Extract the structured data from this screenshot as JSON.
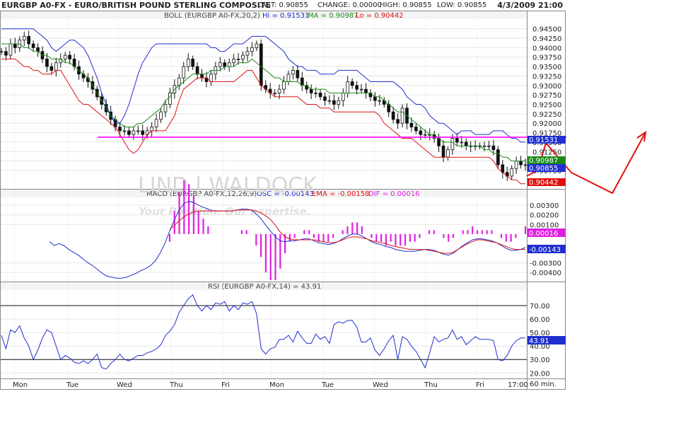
{
  "header": {
    "symbol_title": "EURGBP A0-FX - EURO/BRITISH POUND STERLING COMPOSITE",
    "last": "LAST: 0.90855",
    "change": "CHANGE: 0.00000",
    "high": "HIGH: 0.90855",
    "low": "LOW: 0.90855",
    "datetime": "4/3/2009 21:00"
  },
  "panels": {
    "boll": {
      "title": "BOLL (EURGBP A0-FX,20,2)",
      "hi": "Hi = 0.91531",
      "ma": "MA = 0.90987",
      "lo": "Lo = 0.90442"
    },
    "macd": {
      "title": "MACD (EURGBP A0-FX,12,26,9)",
      "osc": "OSC = -0.00143",
      "ema": "EMA = -0.00158",
      "dif": "DIF = 0.00016"
    },
    "rsi": {
      "title": "RSI (EURGBP A0-FX,14) = 43.91"
    }
  },
  "watermark": {
    "name": "LIND | WALDOCK",
    "tagline": "Your Position. Our expertise."
  },
  "badges": {
    "boll_hi": "0.91531",
    "ma": "0.90987",
    "last": "0.90855",
    "boll_lo": "0.90442",
    "macd_dif": "0.00016",
    "macd_osc": "-0.00143",
    "rsi": "43.91"
  },
  "interval_label": "60 min.",
  "colors": {
    "price_bars": "#111111",
    "upper_band": "#1f2fd0",
    "middle_band": "#1a8a1a",
    "lower_band": "#e01010",
    "macd_line": "#1f2fd0",
    "signal_line": "#e01010",
    "histogram": "#e020e0",
    "rsi_line": "#1f2fd0",
    "drawn_line": "#ff00ff",
    "annotation": "#e01010"
  },
  "chart_data": [
    {
      "type": "line",
      "name": "price",
      "x_tick_labels": [
        "Mon",
        "Tue",
        "Wed",
        "Thu",
        "Fri",
        "Mon",
        "Tue",
        "Wed",
        "Thu",
        "Fri",
        "17:00"
      ],
      "ylim": [
        0.903,
        0.947
      ],
      "y_tick_labels": [
        "0.94500",
        "0.94250",
        "0.94000",
        "0.93750",
        "0.93500",
        "0.93250",
        "0.93000",
        "0.92750",
        "0.92500",
        "0.92250",
        "0.92000",
        "0.91750",
        "0.91500",
        "0.91250",
        "0.91000",
        "0.90750"
      ],
      "grid": true,
      "horizontal_line": 0.9163,
      "series": [
        {
          "role": "close",
          "values": [
            0.939,
            0.938,
            0.941,
            0.94,
            0.942,
            0.943,
            0.941,
            0.94,
            0.939,
            0.937,
            0.935,
            0.934,
            0.936,
            0.937,
            0.938,
            0.937,
            0.935,
            0.933,
            0.932,
            0.931,
            0.929,
            0.927,
            0.925,
            0.923,
            0.921,
            0.919,
            0.918,
            0.918,
            0.917,
            0.918,
            0.918,
            0.917,
            0.918,
            0.919,
            0.921,
            0.923,
            0.925,
            0.928,
            0.93,
            0.932,
            0.935,
            0.937,
            0.935,
            0.933,
            0.932,
            0.931,
            0.933,
            0.935,
            0.936,
            0.935,
            0.936,
            0.937,
            0.937,
            0.938,
            0.939,
            0.94,
            0.941,
            0.93,
            0.929,
            0.928,
            0.928,
            0.929,
            0.931,
            0.933,
            0.934,
            0.932,
            0.93,
            0.929,
            0.928,
            0.928,
            0.927,
            0.926,
            0.926,
            0.925,
            0.926,
            0.928,
            0.931,
            0.93,
            0.929,
            0.929,
            0.928,
            0.927,
            0.926,
            0.926,
            0.925,
            0.923,
            0.921,
            0.92,
            0.924,
            0.92,
            0.919,
            0.918,
            0.917,
            0.917,
            0.917,
            0.916,
            0.914,
            0.911,
            0.913,
            0.916,
            0.915,
            0.915,
            0.914,
            0.914,
            0.914,
            0.914,
            0.914,
            0.914,
            0.913,
            0.909,
            0.907,
            0.906,
            0.908,
            0.91,
            0.909,
            0.909
          ]
        },
        {
          "role": "upper_band",
          "values": [
            0.945,
            0.945,
            0.945,
            0.945,
            0.945,
            0.945,
            0.945,
            0.945,
            0.944,
            0.943,
            0.942,
            0.94,
            0.939,
            0.94,
            0.941,
            0.942,
            0.942,
            0.941,
            0.94,
            0.938,
            0.935,
            0.932,
            0.928,
            0.925,
            0.922,
            0.92,
            0.92,
            0.922,
            0.925,
            0.929,
            0.933,
            0.936,
            0.938,
            0.94,
            0.941,
            0.941,
            0.941,
            0.941,
            0.941,
            0.941,
            0.941,
            0.941,
            0.941,
            0.941,
            0.941,
            0.941,
            0.94,
            0.94,
            0.939,
            0.939,
            0.94,
            0.941,
            0.941,
            0.941,
            0.942,
            0.943,
            0.943,
            0.943,
            0.943,
            0.942,
            0.941,
            0.94,
            0.939,
            0.937,
            0.936,
            0.935,
            0.935,
            0.934,
            0.934,
            0.934,
            0.933,
            0.933,
            0.933,
            0.933,
            0.934,
            0.934,
            0.934,
            0.934,
            0.934,
            0.933,
            0.932,
            0.931,
            0.931,
            0.931,
            0.931,
            0.931,
            0.931,
            0.93,
            0.929,
            0.927,
            0.926,
            0.925,
            0.925,
            0.924,
            0.922,
            0.921,
            0.92,
            0.92,
            0.919,
            0.918,
            0.917,
            0.918,
            0.918,
            0.918,
            0.917,
            0.917,
            0.917,
            0.917,
            0.918,
            0.918,
            0.918,
            0.917,
            0.916,
            0.916,
            0.915,
            0.915
          ]
        },
        {
          "role": "middle_band",
          "values": [
            0.941,
            0.941,
            0.941,
            0.941,
            0.941,
            0.94,
            0.94,
            0.939,
            0.939,
            0.938,
            0.938,
            0.937,
            0.937,
            0.937,
            0.936,
            0.936,
            0.935,
            0.934,
            0.933,
            0.932,
            0.93,
            0.928,
            0.926,
            0.924,
            0.922,
            0.921,
            0.92,
            0.919,
            0.919,
            0.919,
            0.92,
            0.92,
            0.921,
            0.922,
            0.923,
            0.924,
            0.926,
            0.927,
            0.929,
            0.93,
            0.931,
            0.932,
            0.933,
            0.933,
            0.933,
            0.933,
            0.934,
            0.934,
            0.934,
            0.935,
            0.935,
            0.935,
            0.936,
            0.936,
            0.936,
            0.937,
            0.936,
            0.935,
            0.934,
            0.933,
            0.932,
            0.932,
            0.931,
            0.931,
            0.931,
            0.931,
            0.93,
            0.93,
            0.929,
            0.929,
            0.929,
            0.929,
            0.928,
            0.928,
            0.928,
            0.928,
            0.928,
            0.928,
            0.928,
            0.928,
            0.928,
            0.928,
            0.927,
            0.927,
            0.926,
            0.925,
            0.924,
            0.923,
            0.923,
            0.922,
            0.921,
            0.92,
            0.919,
            0.918,
            0.917,
            0.917,
            0.916,
            0.915,
            0.915,
            0.915,
            0.914,
            0.914,
            0.914,
            0.914,
            0.914,
            0.914,
            0.913,
            0.913,
            0.912,
            0.912,
            0.911,
            0.911,
            0.91,
            0.91,
            0.91,
            0.91
          ]
        },
        {
          "role": "lower_band",
          "values": [
            0.937,
            0.937,
            0.937,
            0.937,
            0.936,
            0.935,
            0.935,
            0.934,
            0.934,
            0.933,
            0.933,
            0.933,
            0.934,
            0.934,
            0.932,
            0.93,
            0.928,
            0.926,
            0.925,
            0.925,
            0.924,
            0.923,
            0.922,
            0.921,
            0.92,
            0.919,
            0.917,
            0.915,
            0.913,
            0.912,
            0.913,
            0.915,
            0.917,
            0.918,
            0.918,
            0.918,
            0.918,
            0.92,
            0.922,
            0.926,
            0.929,
            0.93,
            0.931,
            0.932,
            0.932,
            0.932,
            0.931,
            0.931,
            0.931,
            0.931,
            0.931,
            0.931,
            0.932,
            0.933,
            0.934,
            0.934,
            0.932,
            0.93,
            0.929,
            0.928,
            0.927,
            0.927,
            0.927,
            0.927,
            0.927,
            0.927,
            0.926,
            0.925,
            0.925,
            0.925,
            0.924,
            0.924,
            0.924,
            0.923,
            0.923,
            0.923,
            0.923,
            0.923,
            0.923,
            0.923,
            0.923,
            0.923,
            0.923,
            0.922,
            0.92,
            0.919,
            0.918,
            0.917,
            0.916,
            0.916,
            0.916,
            0.915,
            0.914,
            0.913,
            0.912,
            0.911,
            0.911,
            0.911,
            0.911,
            0.911,
            0.911,
            0.911,
            0.911,
            0.911,
            0.911,
            0.911,
            0.911,
            0.911,
            0.91,
            0.908,
            0.907,
            0.906,
            0.905,
            0.905,
            0.904,
            0.904
          ]
        }
      ]
    },
    {
      "type": "line",
      "name": "macd",
      "ylim": [
        -0.0048,
        0.0036
      ],
      "y_tick_labels": [
        "0.00300",
        "0.00200",
        "0.00100",
        "-0.00300",
        "-0.00400"
      ],
      "series": [
        {
          "role": "macd_line",
          "values": [
            null,
            null,
            null,
            null,
            null,
            null,
            null,
            null,
            null,
            null,
            -0.0008,
            -0.0012,
            -0.001,
            -0.0012,
            -0.0016,
            -0.0019,
            -0.0022,
            -0.0026,
            -0.003,
            -0.0033,
            -0.0037,
            -0.0041,
            -0.0044,
            -0.0045,
            -0.0046,
            -0.0046,
            -0.0045,
            -0.0043,
            -0.0041,
            -0.0038,
            -0.0036,
            -0.0033,
            -0.0028,
            -0.002,
            -0.001,
            0.0003,
            0.0015,
            0.0025,
            0.0032,
            0.0034,
            0.0033,
            0.003,
            0.0028,
            0.0026,
            0.0024,
            0.0024,
            0.0024,
            0.0024,
            0.0024,
            0.0025,
            0.0026,
            0.0026,
            0.0025,
            0.0021,
            0.0016,
            0.0009,
            0.0003,
            -0.0003,
            -0.0007,
            -0.0008,
            -0.0007,
            -0.0007,
            -0.0006,
            -0.0005,
            -0.0005,
            -0.0007,
            -0.0009,
            -0.001,
            -0.0011,
            -0.001,
            -0.0008,
            -0.0005,
            -0.0002,
            0.0,
            0.0,
            -0.0002,
            -0.0005,
            -0.0008,
            -0.001,
            -0.0011,
            -0.0013,
            -0.0014,
            -0.0016,
            -0.0017,
            -0.0018,
            -0.0018,
            -0.0018,
            -0.0017,
            -0.0016,
            -0.0016,
            -0.0017,
            -0.0019,
            -0.0021,
            -0.0022,
            -0.002,
            -0.0016,
            -0.0012,
            -0.0009,
            -0.0006,
            -0.0005,
            -0.0005,
            -0.0006,
            -0.0007,
            -0.0009,
            -0.0012,
            -0.0015,
            -0.0017,
            -0.0017,
            -0.0016,
            -0.0014
          ]
        },
        {
          "role": "signal_line",
          "values": [
            null,
            null,
            null,
            null,
            null,
            null,
            null,
            null,
            null,
            null,
            null,
            null,
            null,
            null,
            null,
            null,
            null,
            null,
            null,
            null,
            null,
            null,
            null,
            null,
            null,
            null,
            null,
            null,
            null,
            null,
            null,
            null,
            null,
            null,
            null,
            0.0005,
            0.0009,
            0.0014,
            0.0018,
            0.0021,
            0.0023,
            0.0024,
            0.0024,
            0.0024,
            0.0024,
            0.0024,
            0.0024,
            0.0024,
            0.0024,
            0.0025,
            0.0025,
            0.0025,
            0.0025,
            0.0024,
            0.0022,
            0.0019,
            0.0015,
            0.0009,
            0.0002,
            -0.0003,
            -0.0005,
            -0.0006,
            -0.0006,
            -0.0006,
            -0.0006,
            -0.0006,
            -0.0007,
            -0.0008,
            -0.0009,
            -0.0009,
            -0.0008,
            -0.0006,
            -0.0004,
            -0.0003,
            -0.0003,
            -0.0004,
            -0.0005,
            -0.0007,
            -0.0008,
            -0.0009,
            -0.001,
            -0.0012,
            -0.0013,
            -0.0014,
            -0.0015,
            -0.0016,
            -0.0016,
            -0.0016,
            -0.0016,
            -0.0017,
            -0.0018,
            -0.0019,
            -0.002,
            -0.002,
            -0.0019,
            -0.0016,
            -0.0013,
            -0.001,
            -0.0008,
            -0.0006,
            -0.0006,
            -0.0007,
            -0.0008,
            -0.0009,
            -0.0011,
            -0.0013,
            -0.0015,
            -0.0016,
            -0.0016,
            -0.0016
          ]
        }
      ]
    },
    {
      "type": "line",
      "name": "rsi",
      "ylim": [
        17,
        80
      ],
      "y_tick_labels": [
        "70.00",
        "60.00",
        "50.00",
        "40.00",
        "30.00",
        "20.00"
      ],
      "reference_lines": [
        70,
        30
      ],
      "series": [
        {
          "role": "rsi",
          "values": [
            48,
            38,
            52,
            50,
            55,
            46,
            40,
            30,
            37,
            46,
            52,
            50,
            40,
            30,
            33,
            31,
            28,
            27,
            29,
            27,
            30,
            34,
            24,
            23,
            27,
            30,
            34,
            30,
            29,
            31,
            33,
            33,
            35,
            36,
            38,
            41,
            48,
            51,
            56,
            65,
            70,
            75,
            78,
            70,
            66,
            70,
            67,
            72,
            71,
            73,
            66,
            70,
            67,
            72,
            71,
            73,
            64,
            38,
            34,
            38,
            39,
            45,
            45,
            48,
            43,
            51,
            46,
            42,
            42,
            49,
            45,
            47,
            42,
            56,
            58,
            57,
            59,
            59,
            54,
            43,
            43,
            46,
            37,
            33,
            38,
            44,
            48,
            30,
            47,
            45,
            40,
            36,
            30,
            24,
            35,
            47,
            43,
            45,
            46,
            52,
            45,
            47,
            41,
            44,
            47,
            45,
            45,
            45,
            44,
            30,
            29,
            33,
            40,
            44,
            46,
            46
          ]
        }
      ]
    }
  ]
}
